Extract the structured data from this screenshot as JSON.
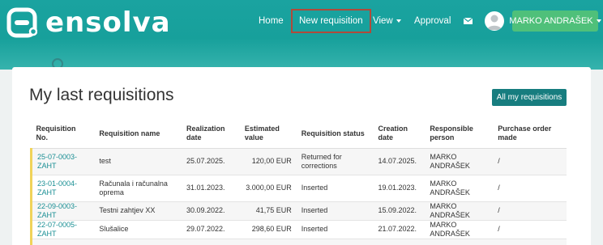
{
  "brand": {
    "name": "ensolva"
  },
  "nav": {
    "home": "Home",
    "new_requisition": "New requisition",
    "view": "View",
    "approval": "Approval",
    "mail_icon": "mail-icon",
    "user_name": "MARKO ANDRAŠEK"
  },
  "colors": {
    "header": "#1aa3a0",
    "user_button": "#4fc07a",
    "primary_button": "#177d7f",
    "link": "#1a8f94",
    "row_marker": "#f0d35a"
  },
  "page": {
    "title": "My last requisitions",
    "all_button": "All my requisitions"
  },
  "table": {
    "headers": [
      "Requisition No.",
      "Requisition name",
      "Realization date",
      "Estimated value",
      "Requisition status",
      "Creation date",
      "Responsible person",
      "Purchase order made"
    ],
    "rows": [
      [
        "25-07-0003-ZAHT",
        "test",
        "25.07.2025.",
        "120,00 EUR",
        "Returned for corrections",
        "14.07.2025.",
        "MARKO ANDRAŠEK",
        "/"
      ],
      [
        "23-01-0004-ZAHT",
        "Računala i računalna oprema",
        "31.01.2023.",
        "3.000,00 EUR",
        "Inserted",
        "19.01.2023.",
        "MARKO ANDRAŠEK",
        "/"
      ],
      [
        "22-09-0003-ZAHT",
        "Testni zahtjev XX",
        "30.09.2022.",
        "41,75 EUR",
        "Inserted",
        "15.09.2022.",
        "MARKO ANDRAŠEK",
        "/"
      ],
      [
        "22-07-0005-ZAHT",
        "Slušalice",
        "29.07.2022.",
        "298,60 EUR",
        "Inserted",
        "21.07.2022.",
        "MARKO ANDRAŠEK",
        "/"
      ]
    ]
  }
}
